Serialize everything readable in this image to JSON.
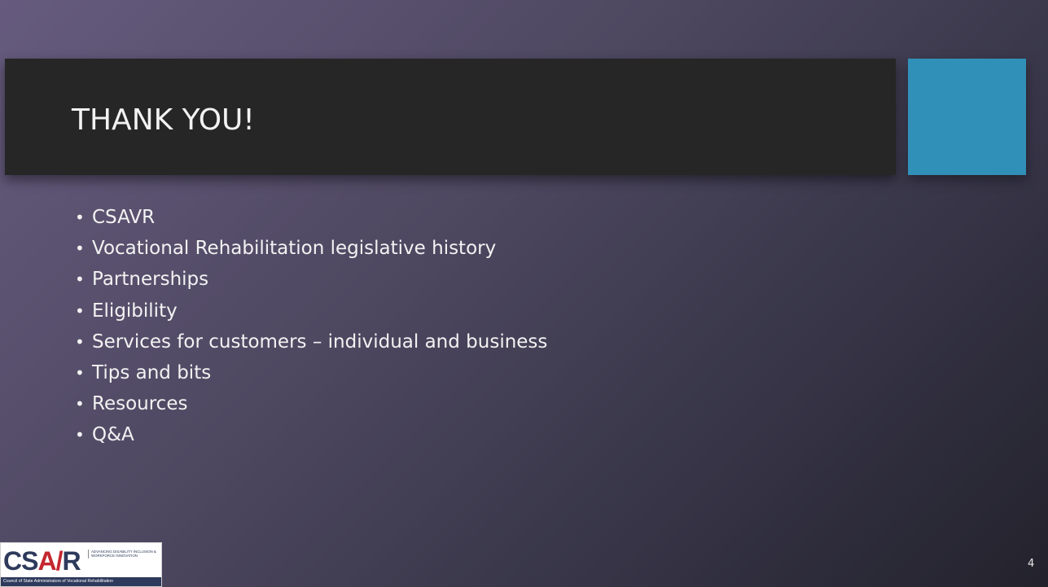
{
  "slide": {
    "title": "THANK YOU!",
    "bullets": [
      "CSAVR",
      "Vocational Rehabilitation legislative history",
      "Partnerships",
      "Eligibility",
      "Services for customers – individual and business",
      "Tips and bits",
      "Resources",
      "Q&A"
    ],
    "bullet_glyph": "•",
    "slide_number": "4"
  },
  "logo": {
    "mark_prefix": "CS",
    "mark_v": "A/",
    "mark_suffix": "R",
    "tagline": "Advancing Disability Inclusion & Workforce Innovation",
    "footer": "Council of State Administrators of Vocational Rehabilitation"
  },
  "colors": {
    "title_bar": "#262626",
    "accent_square": "#3190b8",
    "text": "#f2f2f2",
    "logo_navy": "#2e3a5c",
    "logo_red": "#c4272f"
  }
}
